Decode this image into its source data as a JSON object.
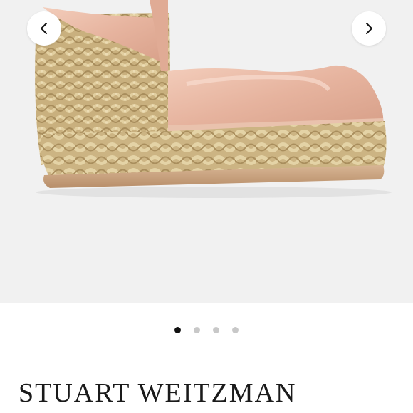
{
  "gallery": {
    "image_subject": "espadrille-wedge-sandal",
    "prev_icon": "chevron-left-icon",
    "next_icon": "chevron-right-icon",
    "image_count": 4,
    "active_index": 0
  },
  "product": {
    "brand": "STUART WEITZMAN"
  },
  "colors": {
    "background": "#f1f1f1",
    "patent_leather": "#e9b9a4",
    "jute": "#cdb586",
    "active_dot": "#111111",
    "inactive_dot": "#c8c8c8"
  }
}
